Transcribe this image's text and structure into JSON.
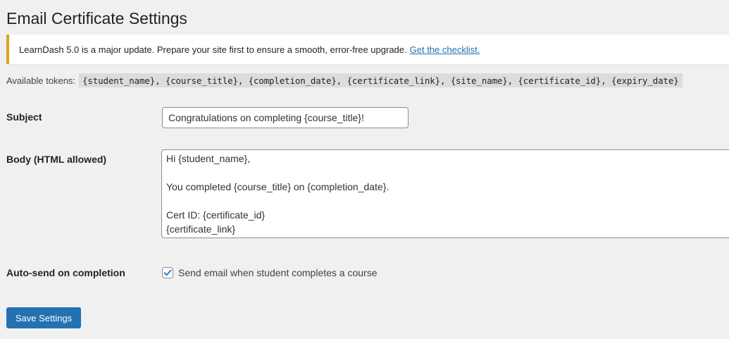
{
  "page": {
    "title": "Email Certificate Settings"
  },
  "notice": {
    "text": "LearnDash 5.0 is a major update. Prepare your site first to ensure a smooth, error-free upgrade.",
    "link_text": "Get the checklist.",
    "border_color": "#dba617",
    "link_color": "#2271b1"
  },
  "tokens": {
    "label": "Available tokens:",
    "items": [
      "{student_name},",
      "{course_title},",
      "{completion_date},",
      "{certificate_link},",
      "{site_name},",
      "{certificate_id},",
      "{expiry_date}"
    ]
  },
  "form": {
    "subject": {
      "label": "Subject",
      "value": "Congratulations on completing {course_title}!"
    },
    "body": {
      "label": "Body (HTML allowed)",
      "value": "Hi {student_name},\n\nYou completed {course_title} on {completion_date}.\n\nCert ID: {certificate_id}\n{certificate_link}"
    },
    "auto_send": {
      "label": "Auto-send on completion",
      "checkbox_label": "Send email when student completes a course",
      "checked": true
    },
    "save_button": {
      "label": "Save Settings",
      "color": "#2271b1"
    }
  }
}
